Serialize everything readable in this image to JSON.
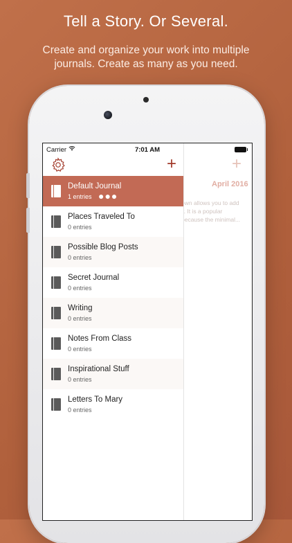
{
  "promo": {
    "headline": "Tell a Story.  Or Several.",
    "subline_1": "Create and organize your work into multiple",
    "subline_2": "journals.  Create as many as you need."
  },
  "statusbar": {
    "carrier": "Carrier",
    "time": "7:01 AM"
  },
  "toolbar": {
    "settings_icon": "gear-icon",
    "add_label": "+"
  },
  "detail_pane": {
    "add_label": "+",
    "month": "April 2016",
    "preview_lines": [
      "own allows you to add",
      "y.  It is a popular",
      "because the minimal..."
    ]
  },
  "journals": [
    {
      "title": "Default Journal",
      "subtitle": "1 entries",
      "more": "●●●"
    },
    {
      "title": "Places Traveled To",
      "subtitle": "0 entries"
    },
    {
      "title": "Possible Blog Posts",
      "subtitle": "0 entries"
    },
    {
      "title": "Secret Journal",
      "subtitle": "0 entries"
    },
    {
      "title": "Writing",
      "subtitle": "0 entries"
    },
    {
      "title": "Notes From Class",
      "subtitle": "0 entries"
    },
    {
      "title": "Inspirational Stuff",
      "subtitle": "0 entries"
    },
    {
      "title": "Letters To Mary",
      "subtitle": "0 entries"
    }
  ],
  "colors": {
    "accent": "#a23a2a",
    "selected_row": "#c26a55",
    "background": "#b8643f"
  }
}
